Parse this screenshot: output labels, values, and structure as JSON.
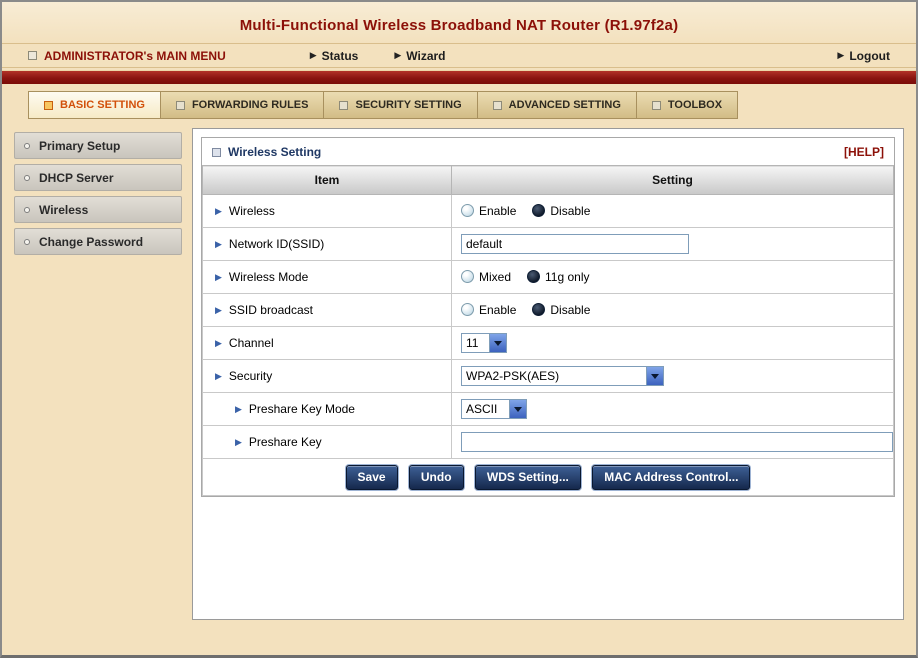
{
  "header": {
    "title": "Multi-Functional Wireless Broadband NAT Router (R1.97f2a)"
  },
  "menubar": {
    "main_menu": "ADMINISTRATOR's MAIN MENU",
    "status": "Status",
    "wizard": "Wizard",
    "logout": "Logout"
  },
  "tabs": [
    {
      "label": "BASIC SETTING",
      "active": true
    },
    {
      "label": "FORWARDING RULES",
      "active": false
    },
    {
      "label": "SECURITY SETTING",
      "active": false
    },
    {
      "label": "ADVANCED SETTING",
      "active": false
    },
    {
      "label": "TOOLBOX",
      "active": false
    }
  ],
  "sidebar": {
    "items": [
      {
        "label": "Primary Setup"
      },
      {
        "label": "DHCP Server"
      },
      {
        "label": "Wireless"
      },
      {
        "label": "Change Password"
      }
    ]
  },
  "panel": {
    "title": "Wireless Setting",
    "help": "[HELP]",
    "columns": {
      "item": "Item",
      "setting": "Setting"
    }
  },
  "rows": {
    "wireless": {
      "label": "Wireless",
      "enable": "Enable",
      "disable": "Disable",
      "selected": "Disable"
    },
    "network_id": {
      "label": "Network ID(SSID)",
      "value": "default"
    },
    "wireless_mode": {
      "label": "Wireless Mode",
      "mixed": "Mixed",
      "g_only": "11g only",
      "selected": "11g only"
    },
    "ssid_broadcast": {
      "label": "SSID broadcast",
      "enable": "Enable",
      "disable": "Disable",
      "selected": "Disable"
    },
    "channel": {
      "label": "Channel",
      "value": "11"
    },
    "security": {
      "label": "Security",
      "value": "WPA2-PSK(AES)"
    },
    "preshare_key_mode": {
      "label": "Preshare Key Mode",
      "value": "ASCII"
    },
    "preshare_key": {
      "label": "Preshare Key",
      "value": ""
    }
  },
  "buttons": {
    "save": "Save",
    "undo": "Undo",
    "wds": "WDS Setting...",
    "mac": "MAC Address Control..."
  },
  "colors": {
    "accent_red": "#8C1008",
    "active_tab_text": "#D2500A",
    "button_navy": "#15284C",
    "page_background": "#F3E1BE"
  }
}
